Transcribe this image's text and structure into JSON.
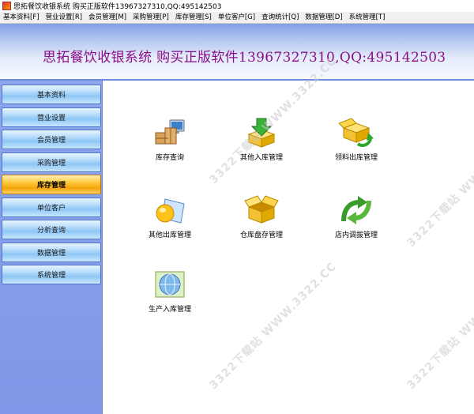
{
  "window": {
    "title": "思拓餐饮收银系统  购买正版软件13967327310,QQ:495142503"
  },
  "menubar": [
    "基本资料[F]",
    "营业设置[R]",
    "会员管理[M]",
    "采购管理[P]",
    "库存管理[S]",
    "单位客户[G]",
    "查询统计[Q]",
    "数据管理[D]",
    "系统管理[T]"
  ],
  "banner": {
    "title": "思拓餐饮收银系统  购买正版软件13967327310,QQ:495142503"
  },
  "sidebar": {
    "items": [
      "基本资料",
      "营业设置",
      "会员管理",
      "采购管理",
      "库存管理",
      "单位客户",
      "分析查询",
      "数据管理",
      "系统管理"
    ],
    "active_index": 4
  },
  "tiles": [
    {
      "label": "库存查询",
      "icon": "computer-boxes-icon"
    },
    {
      "label": "其他入库管理",
      "icon": "box-down-arrow-icon"
    },
    {
      "label": "领料出库管理",
      "icon": "box-refresh-arrow-icon"
    },
    {
      "label": "其他出库管理",
      "icon": "sphere-folder-icon"
    },
    {
      "label": "仓库盘存管理",
      "icon": "open-box-icon"
    },
    {
      "label": "店内调拔管理",
      "icon": "green-arrows-icon"
    },
    {
      "label": "生产入库管理",
      "icon": "globe-icon"
    }
  ],
  "watermark": "3322下载站 WWW.3322.CC",
  "colors": {
    "banner_text": "#8b0f86",
    "sidebar_active": "#f5a40a",
    "sidebar_bg": "#8ea6ee"
  }
}
